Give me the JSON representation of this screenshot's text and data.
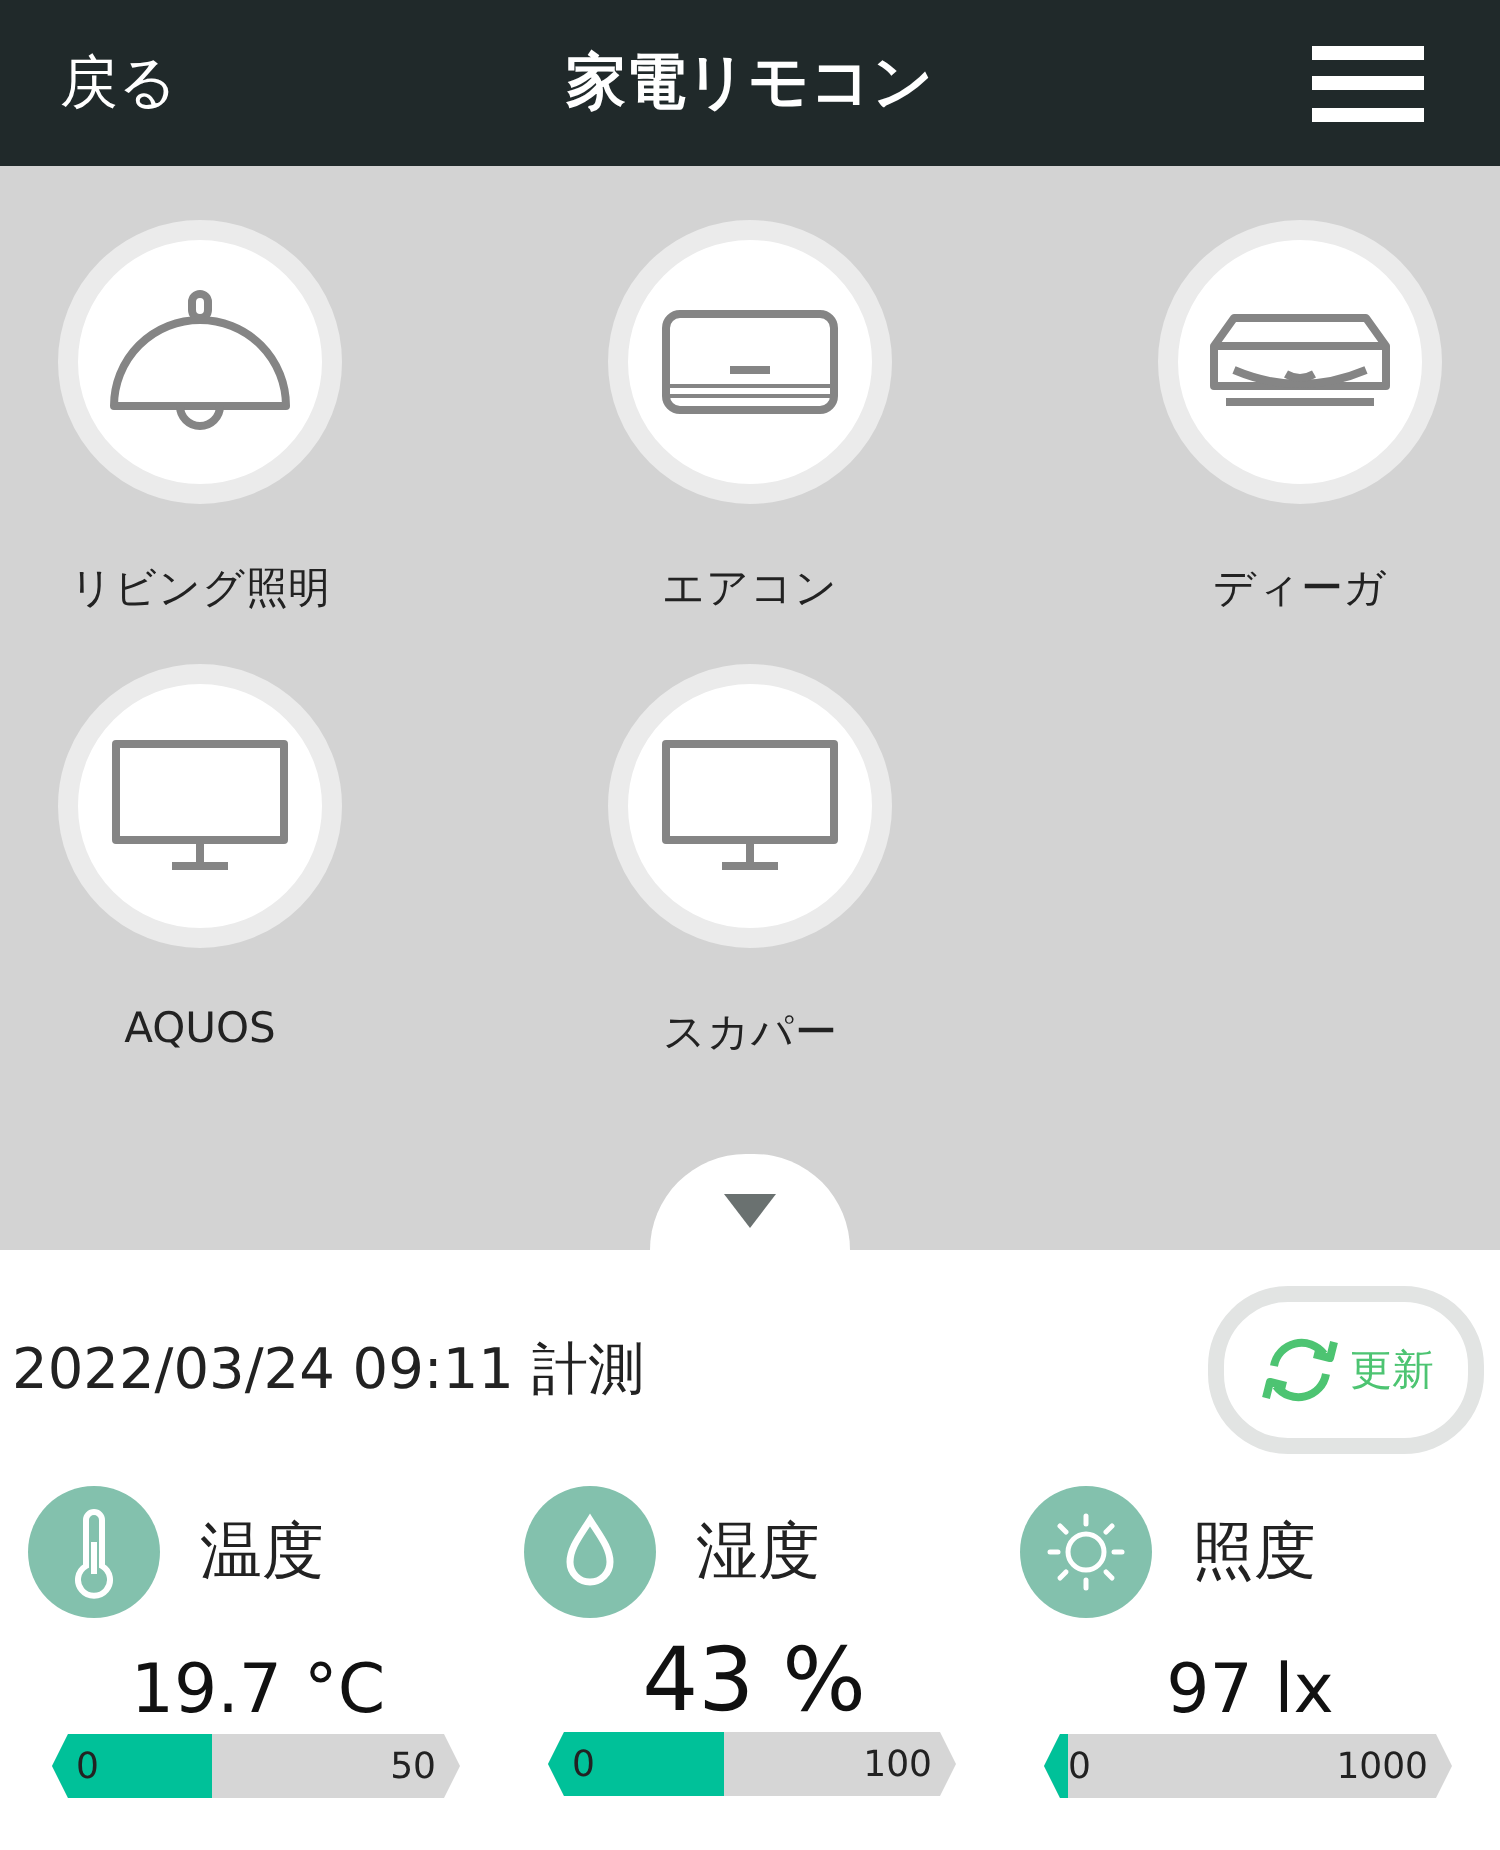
{
  "header": {
    "back": "戻る",
    "title": "家電リモコン"
  },
  "devices": [
    {
      "kind": "lamp",
      "label": "リビング照明"
    },
    {
      "kind": "aircon",
      "label": "エアコン"
    },
    {
      "kind": "recorder",
      "label": "ディーガ"
    },
    {
      "kind": "tv",
      "label": "AQUOS"
    },
    {
      "kind": "tv",
      "label": "スカパー"
    }
  ],
  "measurement": {
    "timestamp": "2022/03/24 09:11 計測",
    "refresh": "更新"
  },
  "sensors": [
    {
      "kind": "thermometer",
      "name": "温度",
      "reading": "19.7 °C",
      "level": 0.39,
      "min": "0",
      "max": "50"
    },
    {
      "kind": "drop",
      "name": "湿度",
      "reading": "43 %",
      "level": 0.43,
      "min": "0",
      "max": "100"
    },
    {
      "kind": "sun",
      "name": "照度",
      "reading": "97 lx",
      "level": 0.06,
      "min": "0",
      "max": "1000"
    }
  ]
}
